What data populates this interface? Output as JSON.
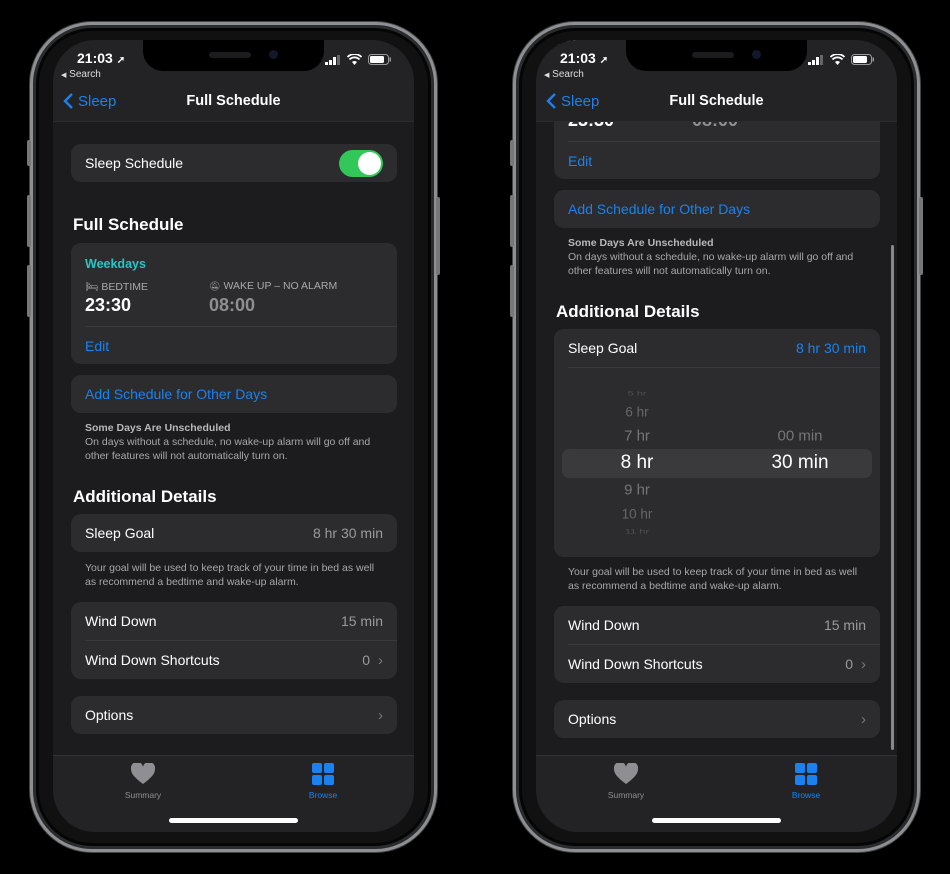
{
  "status": {
    "time": "21:03",
    "back_app": "Search"
  },
  "nav": {
    "back": "Sleep",
    "title": "Full Schedule"
  },
  "sleep_schedule": {
    "label": "Sleep Schedule",
    "enabled": true
  },
  "full_schedule": {
    "header": "Full Schedule",
    "schedule": {
      "days": "Weekdays",
      "bedtime_label": "BEDTIME",
      "bedtime": "23:30",
      "wake_label": "WAKE UP – NO ALARM",
      "wake": "08:00",
      "edit": "Edit"
    },
    "add_schedule": "Add Schedule for Other Days",
    "note_title": "Some Days Are Unscheduled",
    "note_text": "On days without a schedule, no wake-up alarm will go off and other features will not automatically turn on."
  },
  "additional": {
    "header": "Additional Details",
    "sleep_goal": {
      "label": "Sleep Goal",
      "value": "8 hr 30 min"
    },
    "picker": {
      "hours": [
        "5 hr",
        "6 hr",
        "7 hr",
        "8 hr",
        "9 hr",
        "10 hr",
        "11 hr"
      ],
      "selected_hour_index": 3,
      "minutes": [
        "00 min",
        "30 min"
      ],
      "selected_minute_index": 1
    },
    "goal_note": "Your goal will be used to keep track of your time in bed as well as recommend a bedtime and wake-up alarm.",
    "wind_down": {
      "label": "Wind Down",
      "value": "15 min"
    },
    "shortcuts": {
      "label": "Wind Down Shortcuts",
      "value": "0"
    },
    "options": "Options"
  },
  "tabs": [
    {
      "label": "Summary",
      "icon": "heart-icon",
      "active": false
    },
    {
      "label": "Browse",
      "icon": "grid-icon",
      "active": true
    }
  ],
  "colors": {
    "accent": "#1a82f0",
    "toggle_on": "#32c759",
    "weekdays": "#2ac4c4"
  }
}
